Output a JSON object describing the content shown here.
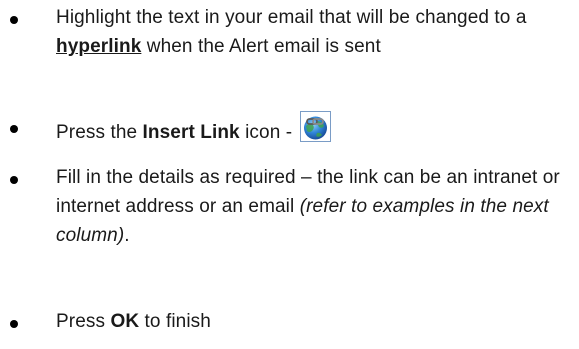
{
  "instructions": [
    {
      "pre": "Highlight the text in your email that will be changed to a ",
      "link_word": "hyperlink",
      "post": " when the Alert email is sent"
    },
    {
      "pre": "Press the ",
      "bold": "Insert Link",
      "post": " icon - ",
      "icon": "insert-link-icon"
    },
    {
      "pre": "Fill in the details as required – the link can be an intranet or internet address or an email ",
      "italic": "(refer to examples in the next column)",
      "post": "."
    },
    {
      "pre": "Press ",
      "bold": "OK",
      "post": " to finish"
    }
  ]
}
